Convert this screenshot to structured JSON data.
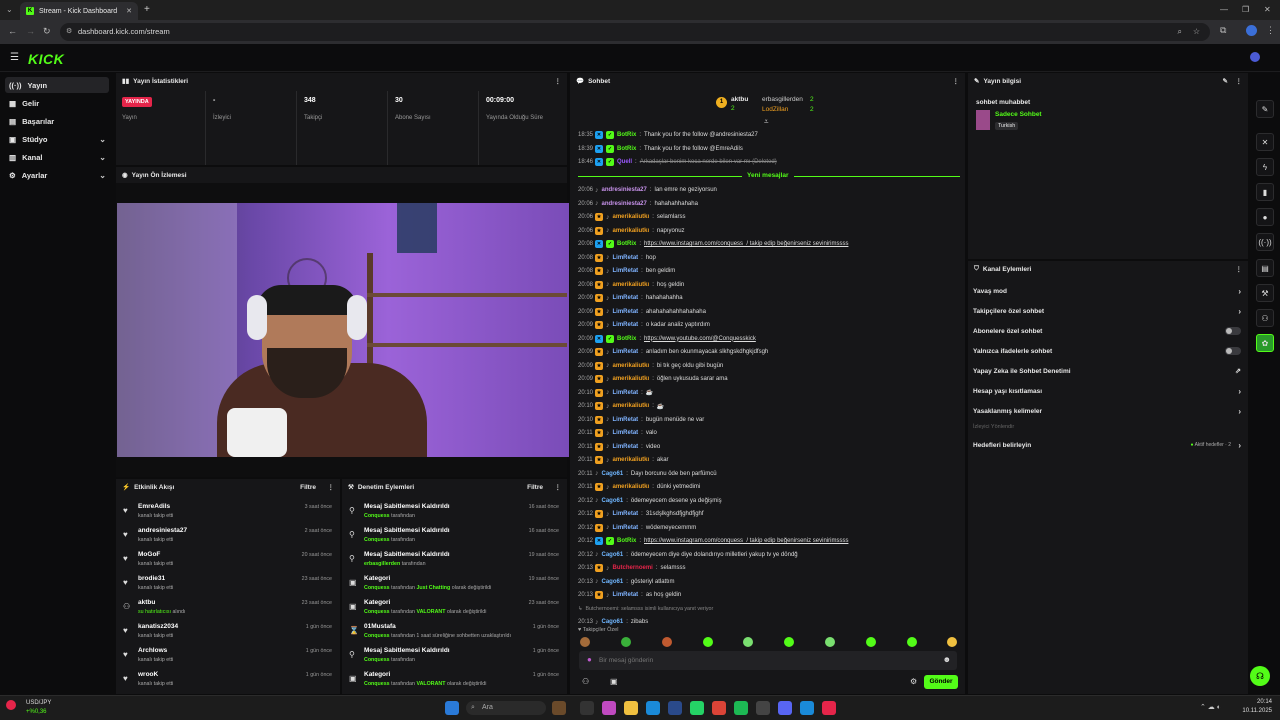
{
  "browser": {
    "tab_title": "Stream - Kick Dashboard",
    "url": "dashboard.kick.com/stream",
    "new_tab_icon": "+"
  },
  "brand": {
    "logo_text": "KICK",
    "accent": "#53fc18"
  },
  "sidebar": {
    "items": [
      {
        "label": "Yayın",
        "icon": "broadcast-icon",
        "active": true
      },
      {
        "label": "Gelir",
        "icon": "revenue-icon"
      },
      {
        "label": "Başarılar",
        "icon": "trophy-icon"
      },
      {
        "label": "Stüdyo",
        "icon": "studio-icon",
        "expandable": true
      },
      {
        "label": "Kanal",
        "icon": "channel-icon",
        "expandable": true
      },
      {
        "label": "Ayarlar",
        "icon": "settings-icon",
        "expandable": true
      }
    ]
  },
  "stats": {
    "title": "Yayın İstatistikleri",
    "live_badge": "YAYINDA",
    "cells": [
      {
        "value": "",
        "label": "Yayın"
      },
      {
        "value": "-",
        "label": "İzleyici"
      },
      {
        "value": "348",
        "label": "Takipçi"
      },
      {
        "value": "30",
        "label": "Abone Sayısı"
      },
      {
        "value": "00:09:00",
        "label": "Yayında Olduğu Süre"
      }
    ]
  },
  "preview": {
    "title": "Yayın Ön İzlemesi"
  },
  "activity": {
    "title": "Etkinlik Akışı",
    "filter": "Filtre",
    "items": [
      {
        "name": "EmreAdils",
        "sub": "kanalı takip etti",
        "time": "3 saat önce"
      },
      {
        "name": "andresiniesta27",
        "sub": "kanalı takip etti",
        "time": "2 saat önce"
      },
      {
        "name": "MoGoF",
        "sub": "kanalı takip etti",
        "time": "20 saat önce"
      },
      {
        "name": "brodie31",
        "sub": "kanalı takip etti",
        "time": "23 saat önce"
      },
      {
        "name": "aktbu",
        "sub_hl": "su hatırlatıcısı",
        "sub": "alındı",
        "time": "23 saat önce"
      },
      {
        "name": "kanatisz2034",
        "sub": "kanalı takip etti",
        "time": "1 gün önce"
      },
      {
        "name": "Archlows",
        "sub": "kanalı takip etti",
        "time": "1 gün önce"
      },
      {
        "name": "wrooK",
        "sub": "kanalı takip etti",
        "time": "1 gün önce"
      }
    ]
  },
  "moderation": {
    "title": "Denetim Eylemleri",
    "filter": "Filtre",
    "items": [
      {
        "title": "Mesaj Sabitlemesi Kaldırıldı",
        "who": "Conquess",
        "rest": "tarafından",
        "time": "16 saat önce",
        "icon": "unpin-icon"
      },
      {
        "title": "Mesaj Sabitlemesi Kaldırıldı",
        "who": "Conquess",
        "rest": "tarafından",
        "time": "16 saat önce",
        "icon": "unpin-icon"
      },
      {
        "title": "Mesaj Sabitlemesi Kaldırıldı",
        "who": "erbasgillerden",
        "rest": "tarafından",
        "time": "19 saat önce",
        "icon": "unpin-icon"
      },
      {
        "title": "Kategori",
        "who": "Conquess",
        "rest": "tarafından",
        "cat": "Just Chatting",
        "rest2": "olarak değiştirildi",
        "time": "19 saat önce",
        "icon": "category-icon"
      },
      {
        "title": "Kategori",
        "who": "Conquess",
        "rest": "tarafından",
        "cat": "VALORANT",
        "rest2": "olarak değiştirildi",
        "time": "23 saat önce",
        "icon": "category-icon"
      },
      {
        "title": "01Mustafa",
        "who": "Conquess",
        "rest": "tarafından 1 saat süreliğine sohbetten uzaklaştırıldı",
        "time": "1 gün önce",
        "icon": "timeout-icon"
      },
      {
        "title": "Mesaj Sabitlemesi Kaldırıldı",
        "who": "Conquess",
        "rest": "tarafından",
        "time": "1 gün önce",
        "icon": "unpin-icon"
      },
      {
        "title": "Kategori",
        "who": "Conquess",
        "rest": "tarafından",
        "cat": "VALORANT",
        "rest2": "olarak değiştirildi",
        "time": "1 gün önce",
        "icon": "category-icon"
      }
    ]
  },
  "chat": {
    "title": "Sohbet",
    "top_gifters": [
      {
        "rank": "1",
        "name": "aktbu",
        "count": "2"
      },
      {
        "name": "erbasgillerden",
        "count": "2"
      },
      {
        "name": "LodZillan",
        "count": "2"
      }
    ],
    "new_messages": "Yeni mesajlar",
    "messages": [
      {
        "t": "18:35",
        "b": "bot",
        "u": "BotRix",
        "uc": "#53fc18",
        "m": "Thank you for the follow @andresiniesta27"
      },
      {
        "t": "18:39",
        "b": "bot",
        "u": "BotRix",
        "uc": "#53fc18",
        "m": "Thank you for the follow @EmreAdils"
      },
      {
        "t": "18:46",
        "b": "bot",
        "u": "Quell",
        "uc": "#9b59ff",
        "m": "Arkadaşlar benim koca nerde bilen var mı (Deleted)",
        "deleted": true
      },
      {
        "t": "20:06",
        "u": "andresiniesta27",
        "uc": "#c792ea",
        "m": "lan emre ne geziyorsun"
      },
      {
        "t": "20:06",
        "u": "andresiniesta27",
        "uc": "#c792ea",
        "m": "hahahahhahaha"
      },
      {
        "t": "20:06",
        "b": "sub",
        "u": "amerikaliutkı",
        "uc": "#f0a020",
        "m": "selamlarss"
      },
      {
        "t": "20:06",
        "b": "sub",
        "u": "amerikaliutkı",
        "uc": "#f0a020",
        "m": "napıyonuz"
      },
      {
        "t": "20:08",
        "b": "bot",
        "u": "BotRix",
        "uc": "#53fc18",
        "m": "https://www.instagram.com/conquess_/ takip edip beğenirseniz sevinirimssss",
        "link": true
      },
      {
        "t": "20:08",
        "b": "sub",
        "u": "LimRetat",
        "uc": "#7fb3ff",
        "m": "hop"
      },
      {
        "t": "20:08",
        "b": "sub",
        "u": "LimRetat",
        "uc": "#7fb3ff",
        "m": "ben geldim"
      },
      {
        "t": "20:08",
        "b": "sub",
        "u": "amerikaliutkı",
        "uc": "#f0a020",
        "m": "hoş geldin"
      },
      {
        "t": "20:09",
        "b": "sub",
        "u": "LimRetat",
        "uc": "#7fb3ff",
        "m": "hahahahahha"
      },
      {
        "t": "20:09",
        "b": "sub",
        "u": "LimRetat",
        "uc": "#7fb3ff",
        "m": "ahahahahahhahahaha"
      },
      {
        "t": "20:09",
        "b": "sub",
        "u": "LimRetat",
        "uc": "#7fb3ff",
        "m": "o kadar analiz yaptırdım"
      },
      {
        "t": "20:09",
        "b": "bot",
        "u": "BotRix",
        "uc": "#53fc18",
        "m": "https://www.youtube.com/@Conquesskick",
        "link": true
      },
      {
        "t": "20:09",
        "b": "sub",
        "u": "LimRetat",
        "uc": "#7fb3ff",
        "m": "anladım ben okunmayacak slkhgskdhgkjdfsgh"
      },
      {
        "t": "20:09",
        "b": "sub",
        "u": "amerikaliutkı",
        "uc": "#f0a020",
        "m": "bi tık geç oldu gibi bugün"
      },
      {
        "t": "20:09",
        "b": "sub",
        "u": "amerikaliutkı",
        "uc": "#f0a020",
        "m": "öğlen uykusuda sarar ama"
      },
      {
        "t": "20:10",
        "b": "sub",
        "u": "LimRetat",
        "uc": "#7fb3ff",
        "m": "☕"
      },
      {
        "t": "20:10",
        "b": "sub",
        "u": "amerikaliutkı",
        "uc": "#f0a020",
        "m": "☕"
      },
      {
        "t": "20:10",
        "b": "sub",
        "u": "LimRetat",
        "uc": "#7fb3ff",
        "m": "bugün menüde ne var"
      },
      {
        "t": "20:11",
        "b": "sub",
        "u": "LimRetat",
        "uc": "#7fb3ff",
        "m": "valo"
      },
      {
        "t": "20:11",
        "b": "sub",
        "u": "LimRetat",
        "uc": "#7fb3ff",
        "m": "video"
      },
      {
        "t": "20:11",
        "b": "sub",
        "u": "amerikaliutkı",
        "uc": "#f0a020",
        "m": "akar"
      },
      {
        "t": "20:11",
        "u": "Cago61",
        "uc": "#6fb6ff",
        "m": "Dayı borcunu öde ben parfümcü"
      },
      {
        "t": "20:11",
        "b": "sub",
        "u": "amerikaliutkı",
        "uc": "#f0a020",
        "m": "dünki yetmedimi"
      },
      {
        "t": "20:12",
        "u": "Cago61",
        "uc": "#6fb6ff",
        "m": "ödemeyecem desene ya değişmiş"
      },
      {
        "t": "20:12",
        "b": "sub",
        "u": "LimRetat",
        "uc": "#7fb3ff",
        "m": "31sdşlkghsdfjghdfjghf"
      },
      {
        "t": "20:12",
        "b": "sub",
        "u": "LimRetat",
        "uc": "#7fb3ff",
        "m": "wödemeyecemmm"
      },
      {
        "t": "20:12",
        "b": "bot",
        "u": "BotRix",
        "uc": "#53fc18",
        "m": "https://www.instagram.com/conquess_/ takip edip beğenirseniz sevinirimssss",
        "link": true
      },
      {
        "t": "20:12",
        "u": "Cago61",
        "uc": "#6fb6ff",
        "m": "ödemeyecem diye diye dolandırıyo milletleri yakup tv ye döndğ"
      },
      {
        "t": "20:13",
        "b": "sub",
        "u": "Butchernoemi",
        "uc": "#e5254a",
        "m": "selamsss"
      },
      {
        "t": "20:13",
        "u": "Cago61",
        "uc": "#6fb6ff",
        "m": "gösteriyl atlattım"
      },
      {
        "t": "20:13",
        "b": "sub",
        "u": "LimRetat",
        "uc": "#7fb3ff",
        "m": "as hoş geldin"
      },
      {
        "t": "",
        "note": true,
        "m": "Butchernoemi: selamsss isimli kullanıcıya yanıt veriyor"
      },
      {
        "t": "20:13",
        "u": "Cago61",
        "uc": "#6fb6ff",
        "m": "zibabs"
      }
    ],
    "followers_only": "Takipçiler Özel",
    "input_placeholder": "Bir mesaj gönderin",
    "send_label": "Gönder"
  },
  "stream_info": {
    "title": "Yayın bilgisi",
    "stream_title": "sohbet muhabbet",
    "category": "Sadece Sohbet",
    "language_tag": "Turkish"
  },
  "channel_actions": {
    "title": "Kanal Eylemleri",
    "items": [
      {
        "label": "Yavaş mod",
        "kind": "arrow"
      },
      {
        "label": "Takipçilere özel sohbet",
        "kind": "arrow"
      },
      {
        "label": "Abonelere özel sohbet",
        "kind": "toggle"
      },
      {
        "label": "Yalnızca ifadelerle sohbet",
        "kind": "toggle"
      },
      {
        "label": "Yapay Zeka ile Sohbet Denetimi",
        "kind": "external"
      },
      {
        "label": "Hesap yaşı kısıtlaması",
        "kind": "arrow"
      },
      {
        "label": "Yasaklanmış kelimeler",
        "kind": "arrow"
      }
    ],
    "section_label": "İzleyici Yönlendir",
    "goals_label": "Hedefleri belirleyin",
    "goals_status": "Aktif hedefler · 2"
  },
  "taskbar": {
    "ticker_name": "USD/JPY",
    "ticker_change": "+%0,36",
    "search_placeholder": "Ara",
    "time": "20:14",
    "date": "10.11.2025"
  }
}
